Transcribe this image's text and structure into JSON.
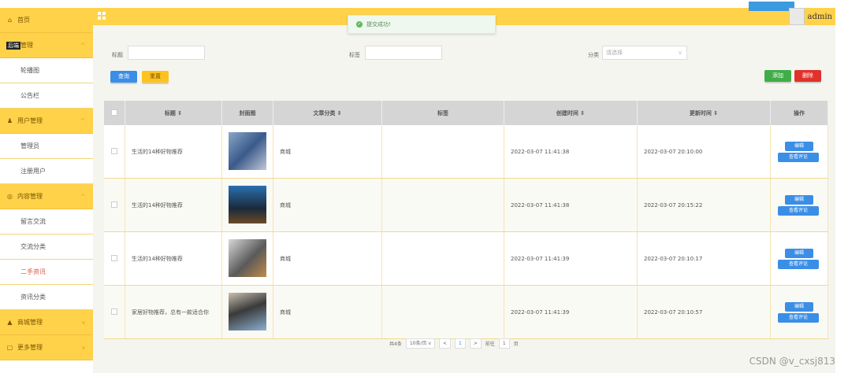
{
  "sidebar": {
    "home": "首页",
    "groups": [
      {
        "label": "管理",
        "overlay": "后端",
        "items": [
          "轮播图",
          "公告栏"
        ]
      },
      {
        "label": "用户管理",
        "items": [
          "管理员",
          "注册用户"
        ]
      },
      {
        "label": "内容管理",
        "items": [
          "留言交流",
          "交流分类",
          "二手资讯",
          "资讯分类"
        ]
      },
      {
        "label": "商城管理",
        "items": []
      },
      {
        "label": "更多管理",
        "items": []
      }
    ]
  },
  "header": {
    "username": "admin",
    "toast": "提交成功!"
  },
  "filters": {
    "title_label": "标题",
    "tag_label": "标签",
    "category_label": "分类",
    "category_placeholder": "请选择"
  },
  "buttons": {
    "search": "查询",
    "reset": "重置",
    "add": "添加",
    "delete": "删除"
  },
  "table": {
    "headers": [
      "标题",
      "封面图",
      "文章分类",
      "标签",
      "创建时间",
      "更新时间",
      "操作"
    ],
    "rows": [
      {
        "title": "生活的14种好物推荐",
        "category": "商城",
        "tag": "",
        "created": "2022-03-07 11:41:38",
        "updated": "2022-03-07 20:10:00"
      },
      {
        "title": "生活的14种好物推荐",
        "category": "商城",
        "tag": "",
        "created": "2022-03-07 11:41:38",
        "updated": "2022-03-07 20:15:22"
      },
      {
        "title": "生活的14种好物推荐",
        "category": "商城",
        "tag": "",
        "created": "2022-03-07 11:41:39",
        "updated": "2022-03-07 20:10:17"
      },
      {
        "title": "家居好物推荐，总有一款适合你",
        "category": "商城",
        "tag": "",
        "created": "2022-03-07 11:41:39",
        "updated": "2022-03-07 20:10:57"
      }
    ],
    "edit_label": "编辑",
    "view_label": "查看评论"
  },
  "pager": {
    "total": "共4条",
    "page_size": "10条/页",
    "current": "1",
    "goto_prefix": "前往",
    "goto_value": "1",
    "goto_suffix": "页"
  },
  "watermark": "CSDN @v_cxsj813"
}
